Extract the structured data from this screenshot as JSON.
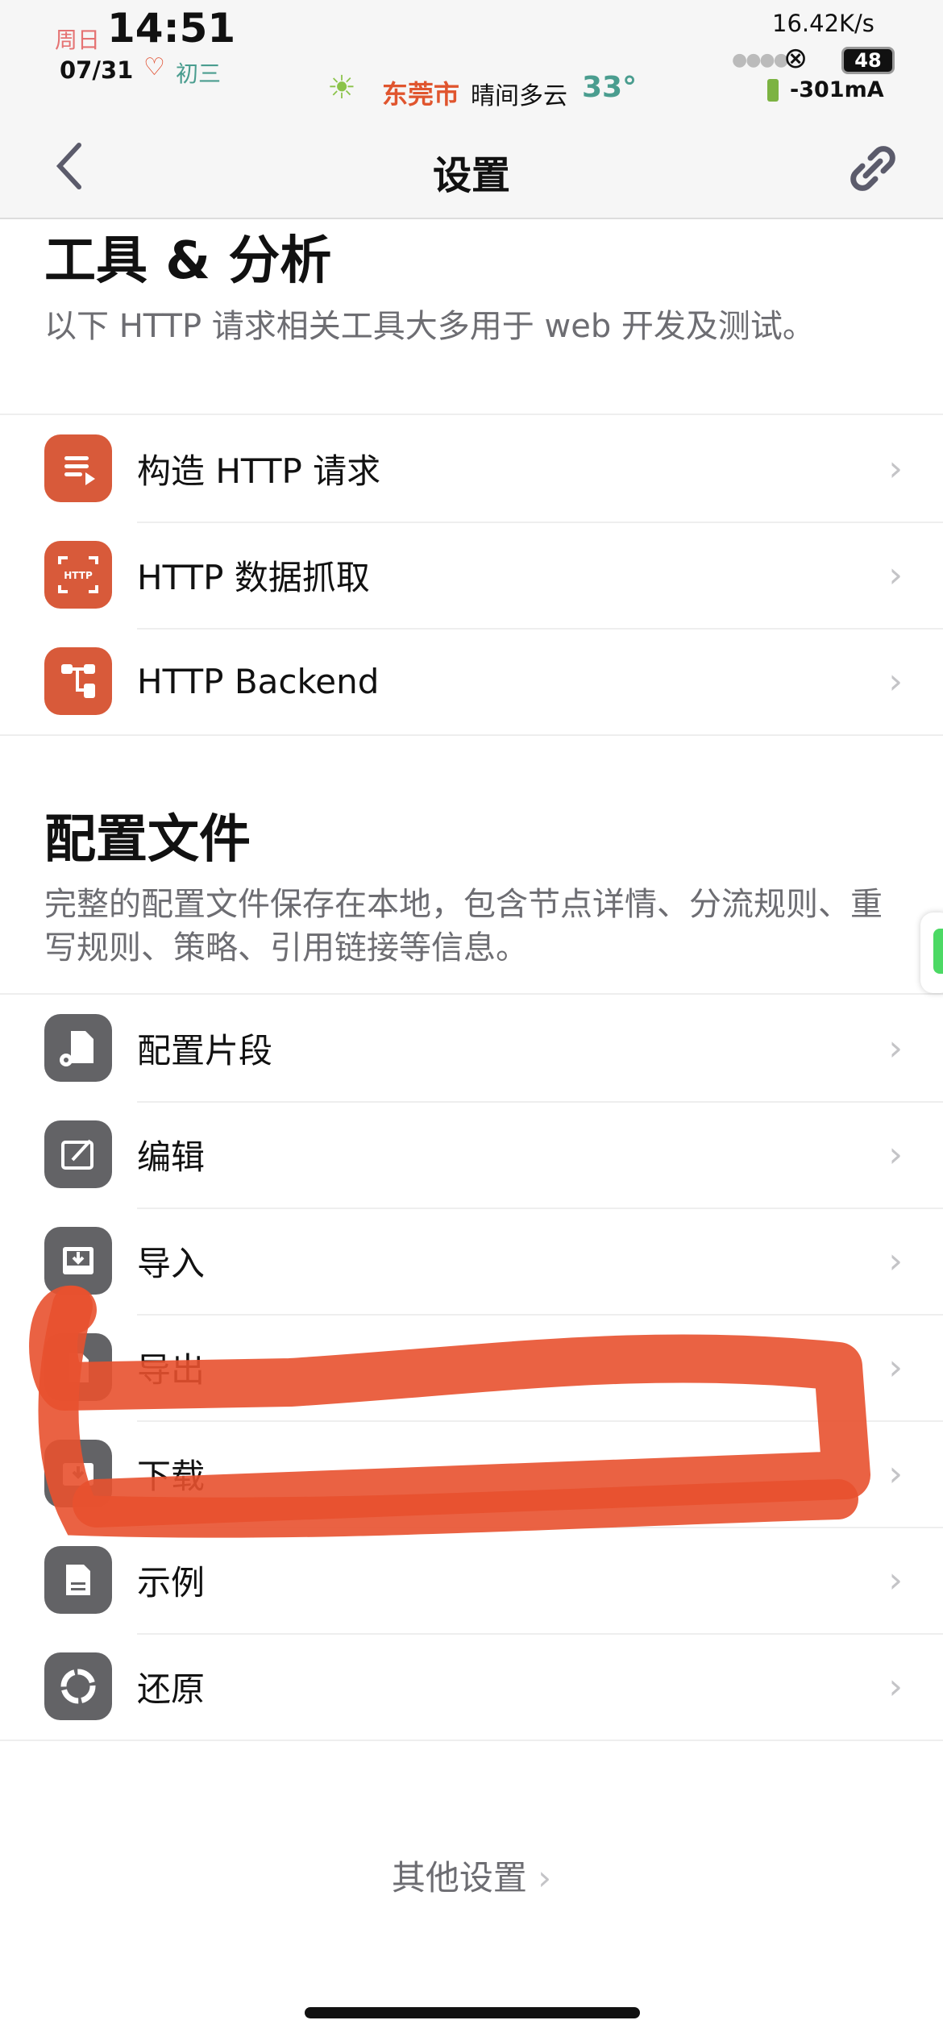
{
  "status_bar": {
    "weekday": "周日",
    "time": "14:51",
    "date": "07/31",
    "lunar": "初三",
    "city": "东莞市",
    "weather": "晴间多云",
    "temperature": "33°",
    "net_speed": "16.42K/s",
    "battery": "48",
    "current": "-301mA"
  },
  "nav": {
    "title": "设置",
    "back_icon": "chevron-left-icon",
    "right_icon": "link-icon"
  },
  "sections": [
    {
      "title": "工具 & 分析",
      "description": "以下 HTTP 请求相关工具大多用于 web 开发及测试。",
      "items": [
        {
          "label": "构造 HTTP 请求",
          "icon": "request-icon"
        },
        {
          "label": "HTTP 数据抓取",
          "icon": "http-capture-icon"
        },
        {
          "label": "HTTP Backend",
          "icon": "backend-icon"
        }
      ]
    },
    {
      "title": "配置文件",
      "description": "完整的配置文件保存在本地，包含节点详情、分流规则、重写规则、策略、引用链接等信息。",
      "items": [
        {
          "label": "配置片段",
          "icon": "config-snippet-icon"
        },
        {
          "label": "编辑",
          "icon": "edit-icon"
        },
        {
          "label": "导入",
          "icon": "import-icon"
        },
        {
          "label": "导出",
          "icon": "export-icon"
        },
        {
          "label": "下载",
          "icon": "download-icon"
        },
        {
          "label": "示例",
          "icon": "example-icon"
        },
        {
          "label": "还原",
          "icon": "restore-icon"
        }
      ]
    }
  ],
  "footer": {
    "other_settings": "其他设置"
  },
  "colors": {
    "accent": "#d85a3a",
    "gray_icon": "#636366",
    "annotation": "#e8512f"
  }
}
